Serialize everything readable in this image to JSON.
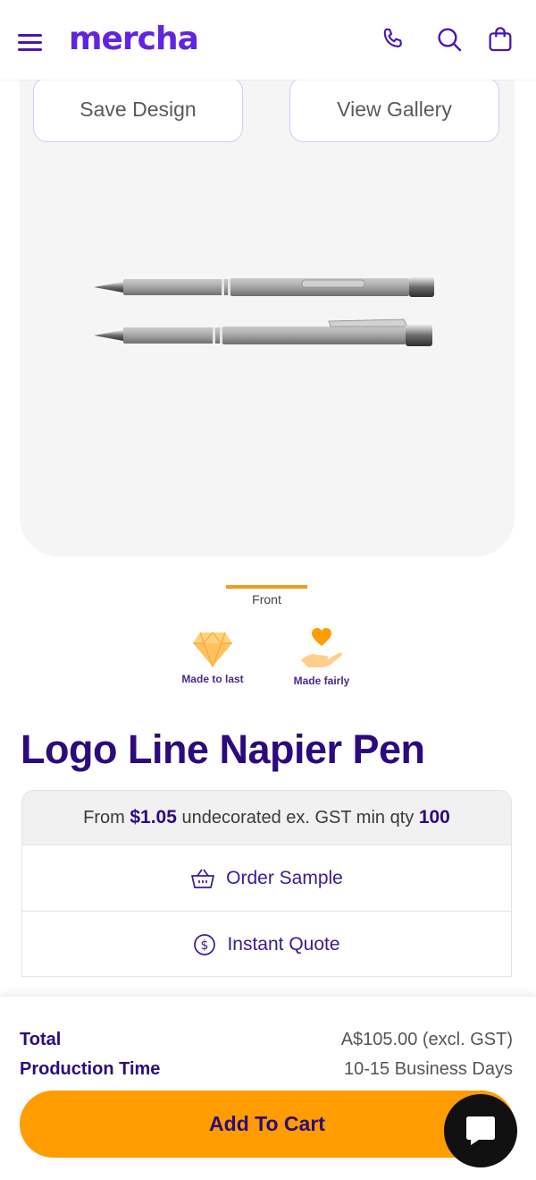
{
  "header": {
    "logo": "mercha",
    "brand_color": "#6224e3",
    "icons": [
      "menu-icon",
      "phone-icon",
      "search-icon",
      "cart-icon"
    ]
  },
  "gallery": {
    "save_design_label": "Save Design",
    "view_gallery_label": "View Gallery",
    "thumb_label": "Front"
  },
  "badges": {
    "made_to_last": "Made to last",
    "made_fairly": "Made fairly"
  },
  "product": {
    "title": "Logo Line Napier Pen",
    "price_prefix": "From",
    "price": "$1.05",
    "price_middle": "undecorated ex. GST min qty",
    "min_qty": "100"
  },
  "actions": {
    "order_sample": "Order Sample",
    "instant_quote": "Instant Quote"
  },
  "footer": {
    "total_label": "Total",
    "total_value": "A$105.00 (excl. GST)",
    "production_label": "Production Time",
    "production_value": "10-15 Business Days",
    "add_to_cart": "Add To Cart",
    "accent_color": "#ff9c00"
  }
}
